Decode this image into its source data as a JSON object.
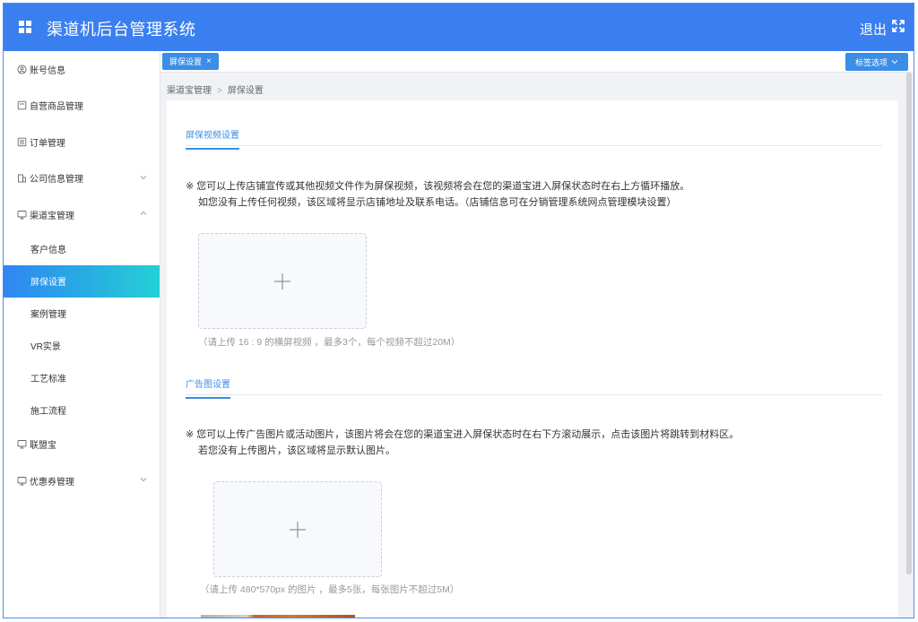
{
  "header": {
    "title": "渠道机后台管理系统",
    "logout_label": "退出"
  },
  "sidebar": {
    "items": [
      {
        "label": "账号信息",
        "icon": "user-circle-icon"
      },
      {
        "label": "自营商品管理",
        "icon": "file-icon"
      },
      {
        "label": "订单管理",
        "icon": "list-icon"
      },
      {
        "label": "公司信息管理",
        "icon": "building-icon"
      },
      {
        "label": "渠道宝管理",
        "icon": "monitor-icon"
      }
    ],
    "subitems": [
      {
        "label": "客户信息"
      },
      {
        "label": "屏保设置"
      },
      {
        "label": "案例管理"
      },
      {
        "label": "VR实景"
      },
      {
        "label": "工艺标准"
      },
      {
        "label": "施工流程"
      }
    ],
    "bottom_items": [
      {
        "label": "联盟宝",
        "icon": "monitor-icon"
      },
      {
        "label": "优惠券管理",
        "icon": "monitor-icon"
      }
    ]
  },
  "tabbar": {
    "active_tab": "屏保设置",
    "close_symbol": "×",
    "options_label": "标签选项"
  },
  "breadcrumb": {
    "parent": "渠道宝管理",
    "separator": ">",
    "current": "屏保设置"
  },
  "video_section": {
    "tab_label": "屏保视频设置",
    "notice_line1": "※ 您可以上传店铺宣传或其他视频文件作为屏保视频，该视频将会在您的渠道宝进入屏保状态时在右上方循环播放。",
    "notice_line2": "如您没有上传任何视频，该区域将显示店铺地址及联系电话。（店铺信息可在分销管理系统网点管理模块设置）",
    "hint": "（请上传 16 : 9 的横屏视频 ，最多3个，每个视频不超过20M）"
  },
  "ad_section": {
    "tab_label": "广告图设置",
    "notice_line1": "※ 您可以上传广告图片或活动图片，该图片将会在您的渠道宝进入屏保状态时在右下方滚动展示，点击该图片将跳转到材料区。",
    "notice_line2": "若您没有上传图片，该区域将显示默认图片。",
    "hint": "（请上传 480*570px 的图片 ，最多5张，每张图片不超过5M）"
  },
  "colors": {
    "primary": "#3a7ff0",
    "tab_blue": "#3a8ee6",
    "active_gradient_start": "#2f86f2",
    "active_gradient_end": "#23cfd6"
  }
}
